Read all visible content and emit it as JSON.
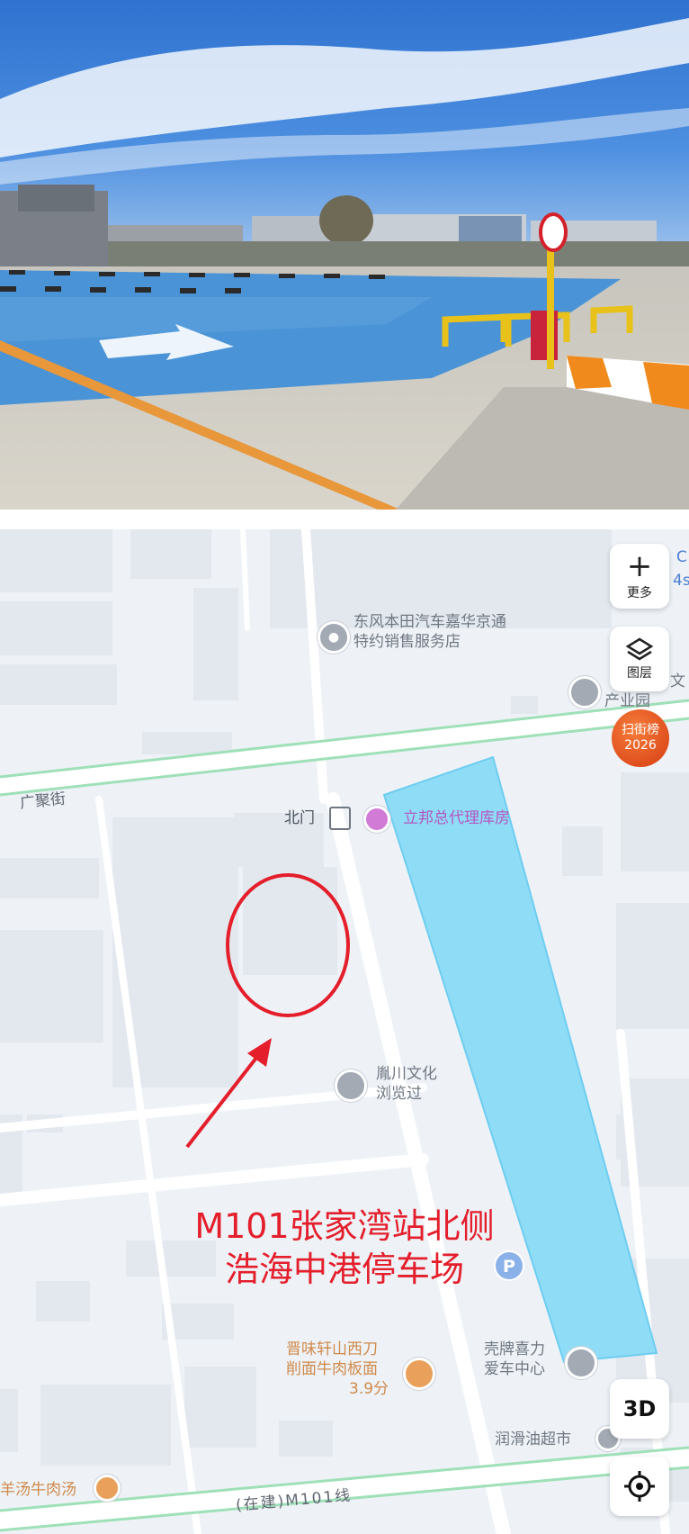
{
  "map": {
    "controls": {
      "more_label": "更多",
      "layers_label": "图层",
      "scan_badge_line1": "扫街榜",
      "scan_badge_line2": "2026",
      "view3d_label": "3D"
    },
    "streets": {
      "guangju": "广聚街",
      "metro_line": "(在建)M101线"
    },
    "pois": {
      "dongfeng_line1": "东风本田汽车嘉华京通",
      "dongfeng_line2": "特约销售服务店",
      "north_gate": "北门",
      "libang": "立邦总代理库房",
      "chanyeyuan_partial": "产业园",
      "right_edge_partial": "文",
      "top_right_partial1": "C",
      "top_right_partial2": "4s",
      "yinchuan_line1": "胤川文化",
      "yinchuan_line2": "浏览过",
      "jinwei_line1": "晋味轩山西刀",
      "jinwei_line2": "削面牛肉板面",
      "jinwei_rating": "3.9分",
      "shell_line1": "壳牌喜力",
      "shell_line2": "爱车中心",
      "runhua": "润滑油超市",
      "yangtang": "羊汤牛肉汤"
    },
    "annotation": {
      "line1": "M101张家湾站北侧",
      "line2": "浩海中港停车场"
    },
    "colors": {
      "annotation": "#e41e2b",
      "highlight_area": "#8fdcf7",
      "road_green": "#9fe0b8",
      "scan_badge": "#e8471c"
    }
  }
}
